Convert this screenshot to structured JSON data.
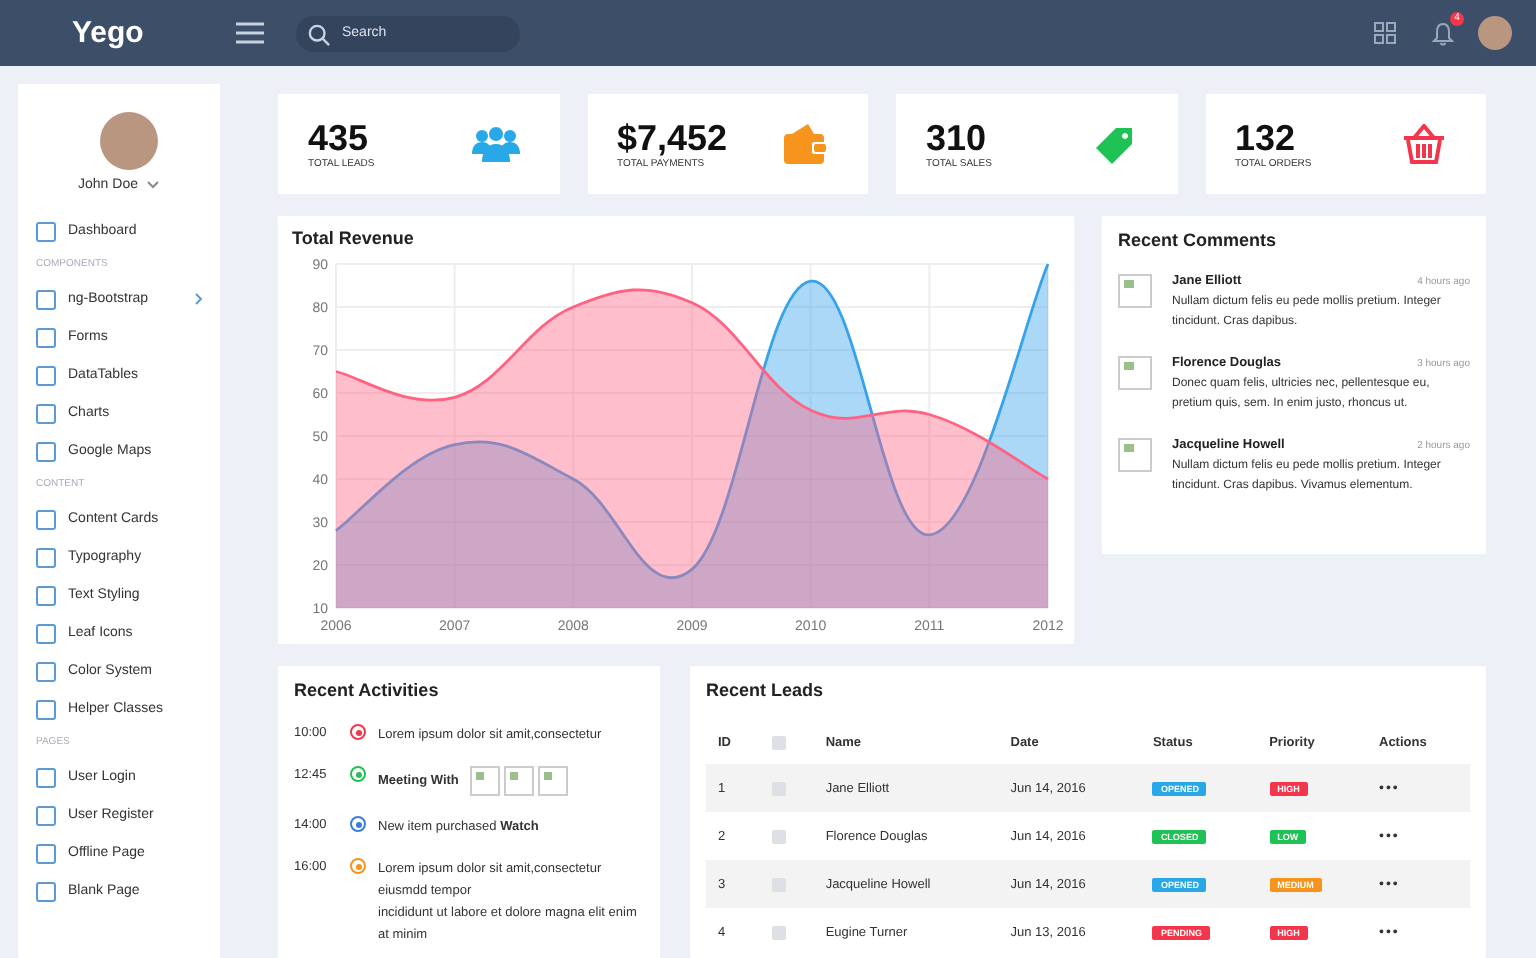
{
  "topbar": {
    "logo": "Yego",
    "search": {
      "placeholder": "Search"
    },
    "notifications": {
      "badge": "4"
    }
  },
  "sidebar": {
    "user": {
      "name": "John Doe"
    },
    "items": [
      {
        "kind": "link",
        "label": "Dashboard",
        "expandable": false
      },
      {
        "kind": "section",
        "label": "COMPONENTS"
      },
      {
        "kind": "link",
        "label": "ng-Bootstrap",
        "expandable": true
      },
      {
        "kind": "link",
        "label": "Forms",
        "expandable": false
      },
      {
        "kind": "link",
        "label": "DataTables",
        "expandable": false
      },
      {
        "kind": "link",
        "label": "Charts",
        "expandable": false
      },
      {
        "kind": "link",
        "label": "Google Maps",
        "expandable": false
      },
      {
        "kind": "section",
        "label": "CONTENT"
      },
      {
        "kind": "link",
        "label": "Content Cards",
        "expandable": false
      },
      {
        "kind": "link",
        "label": "Typography",
        "expandable": false
      },
      {
        "kind": "link",
        "label": "Text Styling",
        "expandable": false
      },
      {
        "kind": "link",
        "label": "Leaf Icons",
        "expandable": false
      },
      {
        "kind": "link",
        "label": "Color System",
        "expandable": false
      },
      {
        "kind": "link",
        "label": "Helper Classes",
        "expandable": false
      },
      {
        "kind": "section",
        "label": "PAGES"
      },
      {
        "kind": "link",
        "label": "User Login",
        "expandable": false
      },
      {
        "kind": "link",
        "label": "User Register",
        "expandable": false
      },
      {
        "kind": "link",
        "label": "Offline Page",
        "expandable": false
      },
      {
        "kind": "link",
        "label": "Blank Page",
        "expandable": false
      }
    ]
  },
  "stats": [
    {
      "value": "435",
      "label": "TOTAL LEADS",
      "kind": "people",
      "color": "#29a8e8"
    },
    {
      "value": "$7,452",
      "label": "TOTAL PAYMENTS",
      "kind": "wallet",
      "color": "#f7941d"
    },
    {
      "value": "310",
      "label": "TOTAL SALES",
      "kind": "tag",
      "color": "#1fc254"
    },
    {
      "value": "132",
      "label": "TOTAL ORDERS",
      "kind": "basket",
      "color": "#f4364c"
    }
  ],
  "revenue": {
    "title": "Total Revenue",
    "chart_data": {
      "type": "area",
      "grid": true,
      "categories": [
        "2006",
        "2007",
        "2008",
        "2009",
        "2010",
        "2011",
        "2012"
      ],
      "ylim": [
        10,
        90
      ],
      "yticks": [
        10,
        20,
        30,
        40,
        50,
        60,
        70,
        80,
        90
      ],
      "series": [
        {
          "color": "#ff6384",
          "values": [
            65,
            59,
            80,
            81,
            56,
            55,
            40
          ]
        },
        {
          "color": "#36a2eb",
          "values": [
            28,
            48,
            40,
            19,
            86,
            27,
            90
          ]
        }
      ]
    }
  },
  "comments": {
    "title": "Recent Comments",
    "items": [
      {
        "name": "Jane Elliott",
        "time": "4 hours ago",
        "text": "Nullam dictum felis eu pede mollis pretium. Integer tincidunt. Cras dapibus."
      },
      {
        "name": "Florence Douglas",
        "time": "3 hours ago",
        "text": "Donec quam felis, ultricies nec, pellentesque eu, pretium quis, sem. In enim justo, rhoncus ut."
      },
      {
        "name": "Jacqueline Howell",
        "time": "2 hours ago",
        "text": "Nullam dictum felis eu pede mollis pretium. Integer tincidunt. Cras dapibus. Vivamus elementum."
      }
    ]
  },
  "activities": {
    "title": "Recent Activities",
    "items": [
      {
        "time": "10:00",
        "color": "#f4364c",
        "lines": [
          "Lorem ipsum dolor sit amit,consectetur"
        ]
      },
      {
        "time": "12:45",
        "color": "#1fc254",
        "lines": [
          "**Meeting With**"
        ],
        "attachments": [
          {
            "kind": "image"
          },
          {
            "kind": "image"
          },
          {
            "kind": "image"
          }
        ]
      },
      {
        "time": "14:00",
        "color": "#3b7ddd",
        "lines": [
          "New item purchased **Watch**"
        ]
      },
      {
        "time": "16:00",
        "color": "#f7941d",
        "lines": [
          "Lorem ipsum dolor sit amit,consectetur",
          "eiusmdd tempor",
          "incididunt ut labore et dolore magna elit enim at minim"
        ]
      }
    ]
  },
  "leads": {
    "title": "Recent Leads",
    "header_checkbox": {
      "checked": false
    },
    "columns": [
      "ID",
      "Name",
      "Date",
      "Status",
      "Priority",
      "Actions"
    ],
    "rows": [
      {
        "id": "1",
        "checked": false,
        "name": "Jane Elliott",
        "date": "Jun 14, 2016",
        "status": {
          "text": "OPENED",
          "color": "#29a8e8"
        },
        "priority": {
          "text": "HIGH",
          "color": "#f4364c"
        },
        "actions": "•••"
      },
      {
        "id": "2",
        "checked": false,
        "name": "Florence Douglas",
        "date": "Jun 14, 2016",
        "status": {
          "text": "CLOSED",
          "color": "#1fc254"
        },
        "priority": {
          "text": "LOW",
          "color": "#1fc254"
        },
        "actions": "•••"
      },
      {
        "id": "3",
        "checked": false,
        "name": "Jacqueline Howell",
        "date": "Jun 14, 2016",
        "status": {
          "text": "OPENED",
          "color": "#29a8e8"
        },
        "priority": {
          "text": "MEDIUM",
          "color": "#f7941d"
        },
        "actions": "•••"
      },
      {
        "id": "4",
        "checked": false,
        "name": "Eugine Turner",
        "date": "Jun 13, 2016",
        "status": {
          "text": "PENDING",
          "color": "#f4364c"
        },
        "priority": {
          "text": "HIGH",
          "color": "#f4364c"
        },
        "actions": "•••"
      }
    ]
  }
}
